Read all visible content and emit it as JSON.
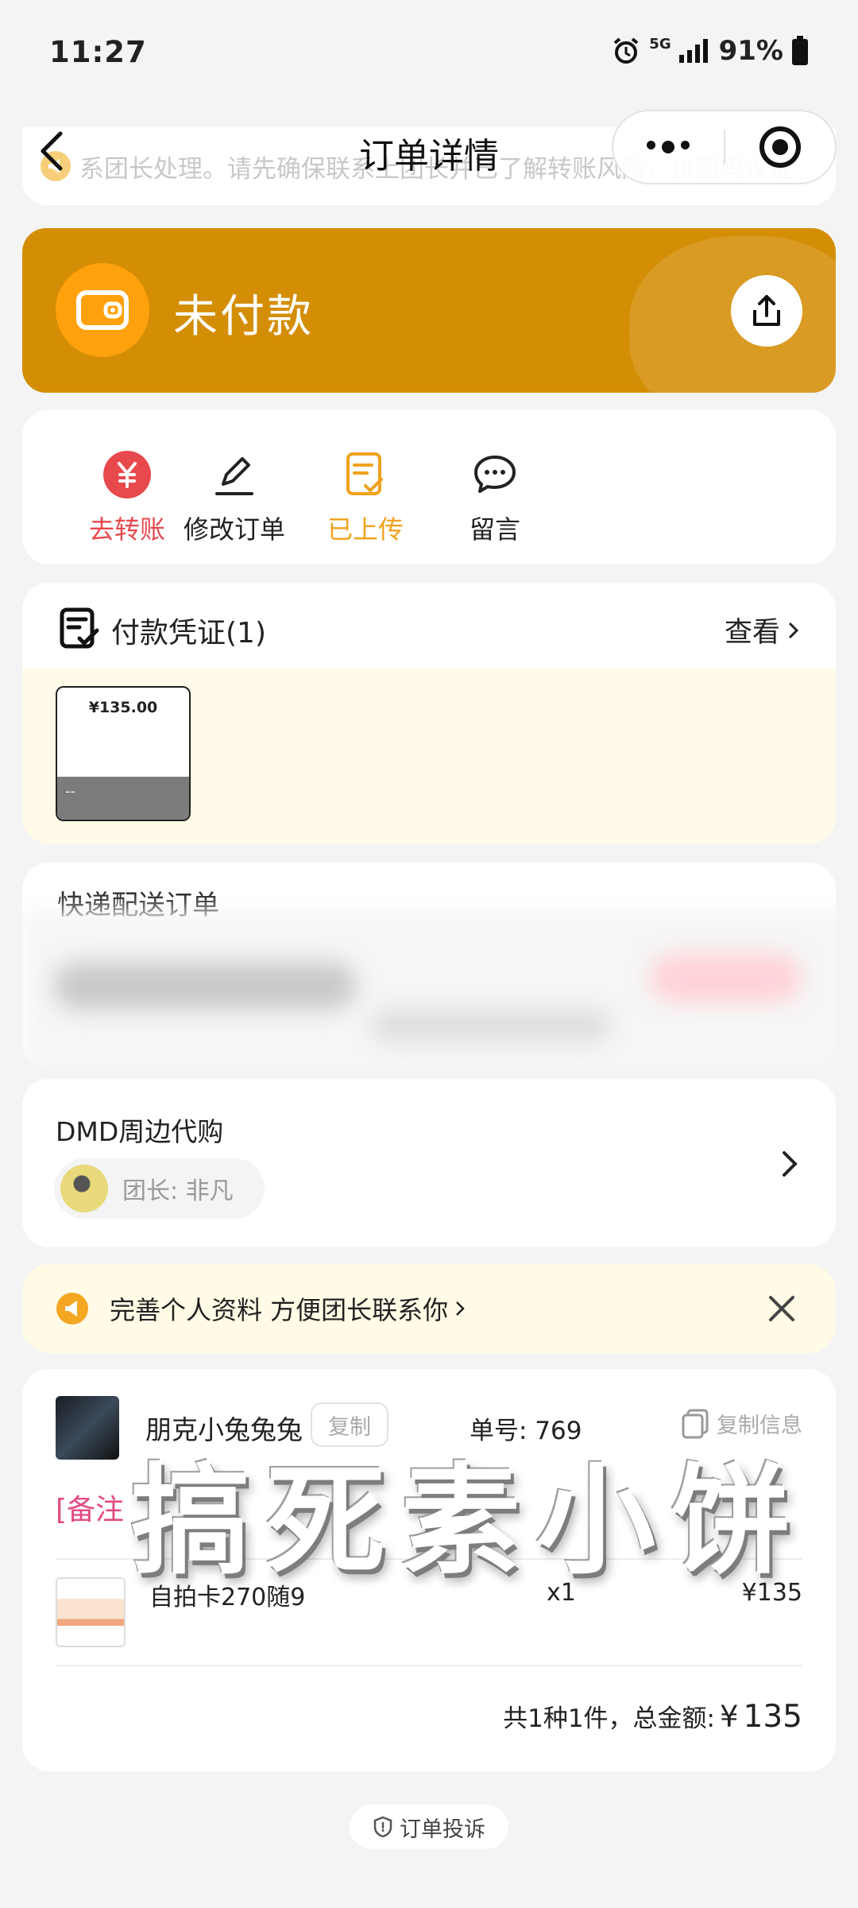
{
  "status_bar": {
    "time": "11:27",
    "network": "5G",
    "battery": "91%"
  },
  "nav": {
    "title": "订单详情"
  },
  "notice": {
    "text": "系团长处理。请先确保联系上团长并已了解转账风险，拼团吗仅提"
  },
  "banner": {
    "status": "未付款",
    "color": "#d48e06"
  },
  "actions": [
    {
      "label": "去转账",
      "color": "#e8494d",
      "icon": "yuan-icon"
    },
    {
      "label": "修改订单",
      "color": "#222222",
      "icon": "pencil-icon"
    },
    {
      "label": "已上传",
      "color": "#f0a11d",
      "icon": "document-check-icon"
    },
    {
      "label": "留言",
      "color": "#222222",
      "icon": "chat-bubble-icon"
    }
  ],
  "voucher": {
    "title": "付款凭证(1)",
    "view_label": "查看",
    "thumb_amount": "¥135.00",
    "thumb_caption": "--"
  },
  "delivery": {
    "title": "快递配送订单"
  },
  "group": {
    "name": "DMD周边代购",
    "leader_label": "团长: 非凡"
  },
  "tip": {
    "text": "完善个人资料 方便团长联系你"
  },
  "order": {
    "buyer": "朋克小兔兔兔",
    "copy_label": "复制",
    "order_no": "单号: 769",
    "copy_info_label": "复制信息",
    "note": "[备注",
    "item_name": "自拍卡270随9",
    "item_qty": "x1",
    "item_price": "¥135",
    "summary_label": "共1种1件，总金额:",
    "currency": "¥",
    "total": "135"
  },
  "watermark": "搞死素小饼",
  "complaint": {
    "label": "订单投诉"
  }
}
